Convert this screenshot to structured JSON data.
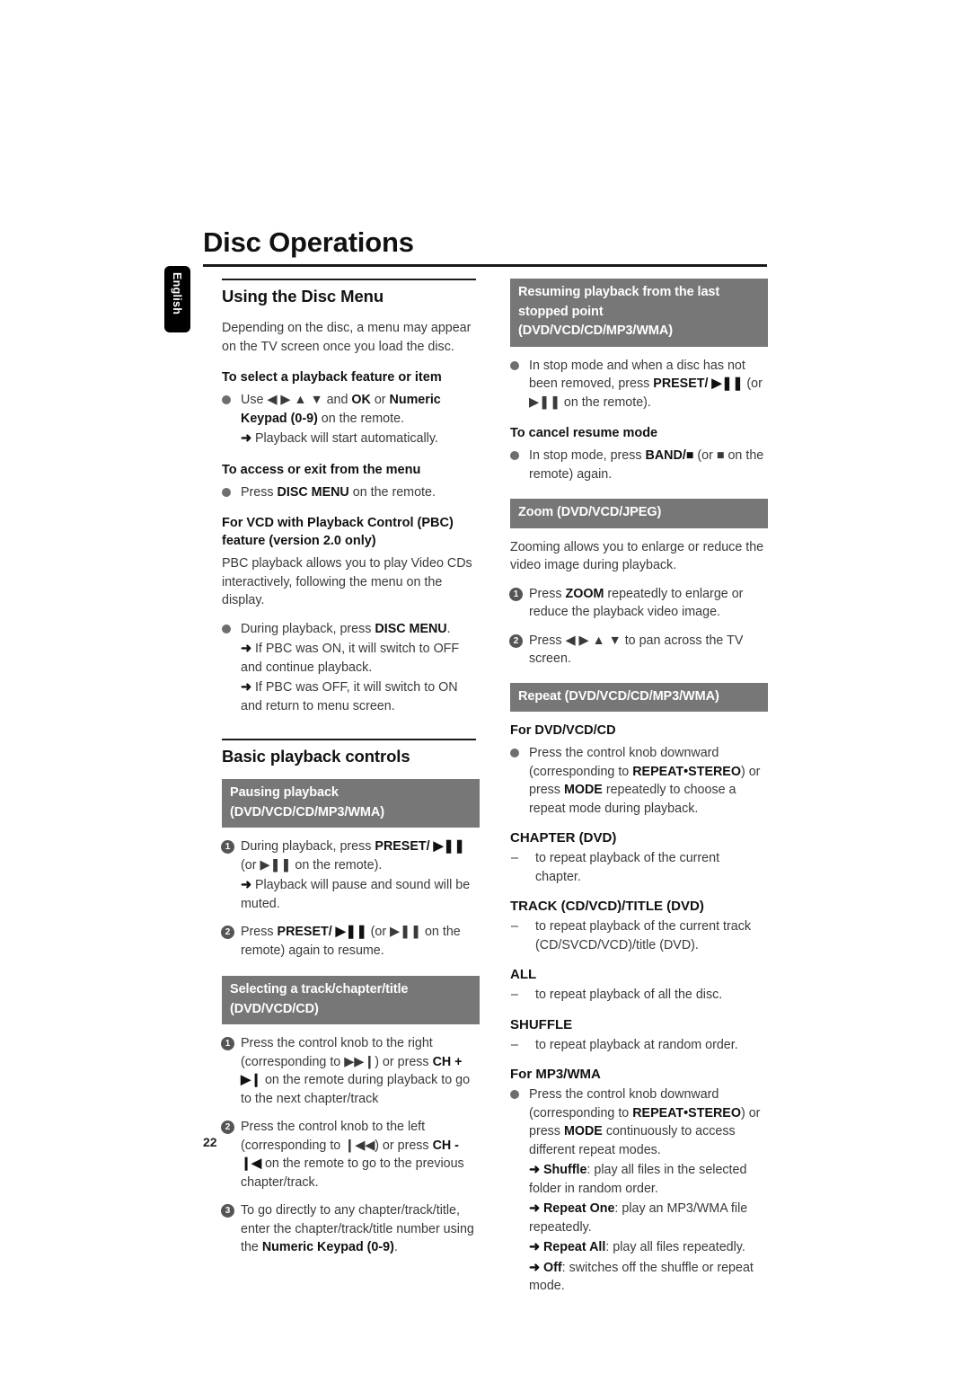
{
  "page": {
    "title": "Disc Operations",
    "language_tab": "English",
    "page_number": "22"
  },
  "left_column": {
    "section1": {
      "heading": "Using the Disc Menu",
      "intro": "Depending on the disc, a menu may appear on the TV screen once you load the disc.",
      "sub1": {
        "heading": "To select a playback feature or item",
        "bullet": "Use ◀ ▶ ▲ ▼ and OK or Numeric Keypad (0-9) on the remote.",
        "arrow": "➜ Playback will start automatically."
      },
      "sub2": {
        "heading": "To access or exit from the menu",
        "bullet": "Press DISC MENU on the remote."
      },
      "sub3": {
        "heading": "For VCD with Playback Control (PBC) feature (version 2.0 only)",
        "body": "PBC playback allows you to play Video CDs interactively, following the menu on the display.",
        "bullet": "During playback, press DISC MENU.",
        "arrow1": "➜ If PBC was ON, it will switch to OFF and continue playback.",
        "arrow2": "➜ If PBC was OFF, it will switch to ON and return to menu screen."
      }
    },
    "section2": {
      "heading": "Basic playback controls",
      "banner1": "Pausing playback (DVD/VCD/CD/MP3/WMA)",
      "step1": "During playback, press PRESET/ ▶❚❚ (or ▶❚❚ on the remote).",
      "step1_arrow": "➜ Playback will pause and sound will be muted.",
      "step2": "Press PRESET/ ▶❚❚ (or ▶❚❚ on the remote) again to resume.",
      "banner2": "Selecting a track/chapter/title (DVD/VCD/CD)",
      "sel_step1": "Press the control knob to the right (corresponding to ▶▶❙) or press CH + ▶❙ on the remote during playback to go to the next chapter/track",
      "sel_step2": "Press the control knob to the left (corresponding to ❙◀◀) or press CH - ❙◀ on the remote to go to the previous chapter/track.",
      "sel_step3": "To go directly to any chapter/track/title, enter the chapter/track/title number using the Numeric Keypad (0-9)."
    }
  },
  "right_column": {
    "resume": {
      "banner": "Resuming playback from the last stopped point (DVD/VCD/CD/MP3/WMA)",
      "bullet": "In stop mode and when a disc has not been removed, press PRESET/ ▶❚❚ (or ▶❚❚ on the remote).",
      "cancel_heading": "To cancel resume mode",
      "cancel_bullet": "In stop mode, press BAND/■ (or ■ on the remote) again."
    },
    "zoom": {
      "banner": "Zoom (DVD/VCD/JPEG)",
      "body": "Zooming allows you to enlarge or reduce the video image during playback.",
      "step1": "Press ZOOM repeatedly to enlarge or reduce the playback video image.",
      "step2": "Press ◀ ▶ ▲ ▼ to pan across the TV screen."
    },
    "repeat": {
      "banner": "Repeat (DVD/VCD/CD/MP3/WMA)",
      "dvd_heading": "For DVD/VCD/CD",
      "dvd_bullet": "Press the control knob downward (corresponding to REPEAT•STEREO) or press MODE repeatedly to choose a repeat mode during playback.",
      "modes": [
        {
          "name": "CHAPTER (DVD)",
          "desc": "to repeat playback of the current chapter."
        },
        {
          "name": "TRACK (CD/VCD)/TITLE (DVD)",
          "desc": "to repeat playback of the current track (CD/SVCD/VCD)/title (DVD)."
        },
        {
          "name": "ALL",
          "desc": "to repeat playback of all the disc."
        },
        {
          "name": "SHUFFLE",
          "desc": "to repeat playback at random order."
        }
      ],
      "mp3_heading": "For MP3/WMA",
      "mp3_bullet": "Press the control knob downward (corresponding to REPEAT•STEREO) or press MODE continuously to access different repeat modes.",
      "mp3_arrows": [
        "➜ Shuffle: play all files in the selected folder in random order.",
        "➜ Repeat One: play an MP3/WMA file repeatedly.",
        "➜ Repeat All: play all files repeatedly.",
        "➜ Off: switches off the shuffle or repeat mode."
      ]
    }
  }
}
